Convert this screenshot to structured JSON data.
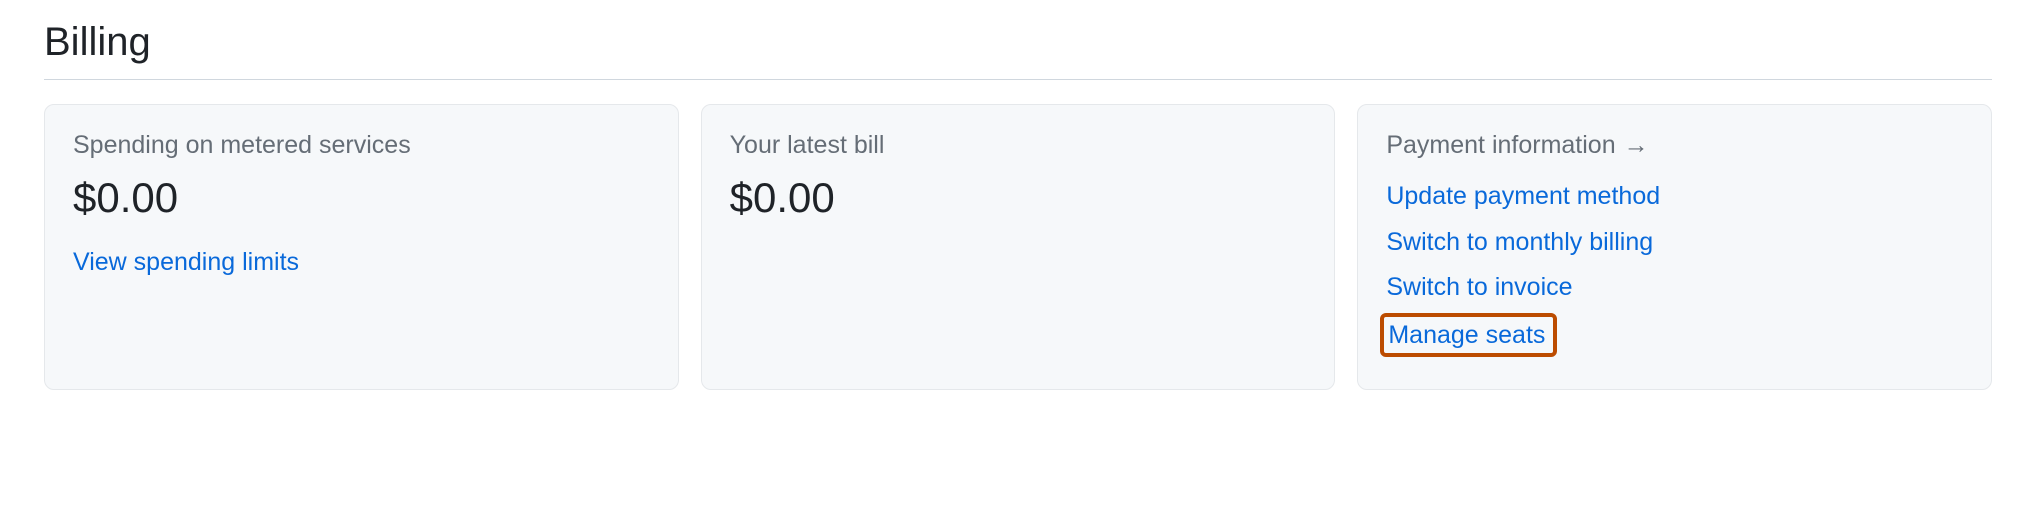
{
  "page": {
    "title": "Billing"
  },
  "cards": {
    "spending": {
      "label": "Spending on metered services",
      "amount": "$0.00",
      "link": "View spending limits"
    },
    "latest_bill": {
      "label": "Your latest bill",
      "amount": "$0.00"
    },
    "payment_info": {
      "label": "Payment information",
      "arrow": "→",
      "links": {
        "update_payment": "Update payment method",
        "switch_monthly": "Switch to monthly billing",
        "switch_invoice": "Switch to invoice",
        "manage_seats": "Manage seats"
      }
    }
  }
}
